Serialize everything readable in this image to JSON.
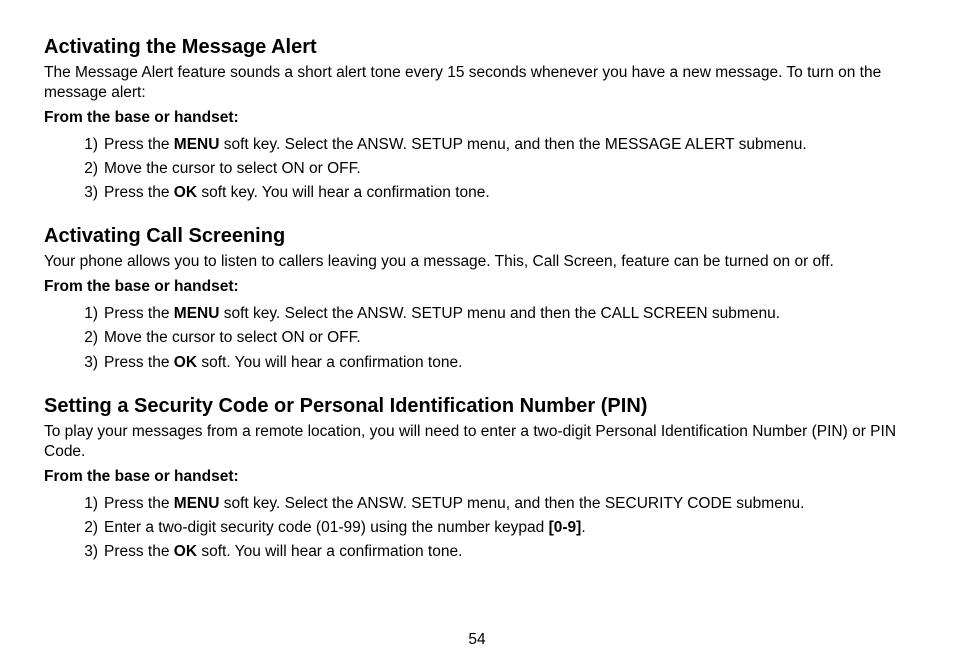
{
  "page_number": "54",
  "sections": [
    {
      "heading": "Activating the Message Alert",
      "intro": "The Message Alert feature sounds a short alert tone every 15 seconds whenever you have a new message. To turn on the message alert:",
      "subhead": "From the base or handset:",
      "steps": [
        {
          "num": "1)",
          "pre": "Press the ",
          "bold": "MENU",
          "post": " soft key. Select the ANSW. SETUP menu, and then the MESSAGE ALERT submenu."
        },
        {
          "num": "2)",
          "pre": "Move the cursor to select ON or OFF.",
          "bold": "",
          "post": ""
        },
        {
          "num": "3)",
          "pre": "Press the ",
          "bold": "OK",
          "post": " soft key. You will hear a confirmation tone."
        }
      ]
    },
    {
      "heading": "Activating Call Screening",
      "intro": "Your phone allows you to listen to callers leaving you a message. This, Call Screen, feature can be turned on or off.",
      "subhead": "From the base or handset:",
      "steps": [
        {
          "num": "1)",
          "pre": "Press the ",
          "bold": "MENU",
          "post": " soft key. Select the ANSW. SETUP menu and then the CALL SCREEN submenu."
        },
        {
          "num": "2)",
          "pre": "Move the cursor to select ON or OFF.",
          "bold": "",
          "post": ""
        },
        {
          "num": "3)",
          "pre": "Press the ",
          "bold": "OK",
          "post": " soft. You will hear a confirmation tone."
        }
      ]
    },
    {
      "heading": "Setting a Security Code or Personal Identification Number (PIN)",
      "intro": "To play your messages from a remote location, you will need to enter a two-digit Personal Identification Number (PIN) or PIN Code.",
      "subhead": "From the base or handset:",
      "steps": [
        {
          "num": "1)",
          "pre": "Press the ",
          "bold": "MENU",
          "post": " soft key. Select the ANSW. SETUP menu, and then the SECURITY CODE submenu."
        },
        {
          "num": "2)",
          "pre": "Enter a two-digit security code (01-99) using the number keypad ",
          "bold": "[0-9]",
          "post": "."
        },
        {
          "num": "3)",
          "pre": "Press the ",
          "bold": "OK",
          "post": " soft. You will hear a confirmation tone."
        }
      ]
    }
  ]
}
